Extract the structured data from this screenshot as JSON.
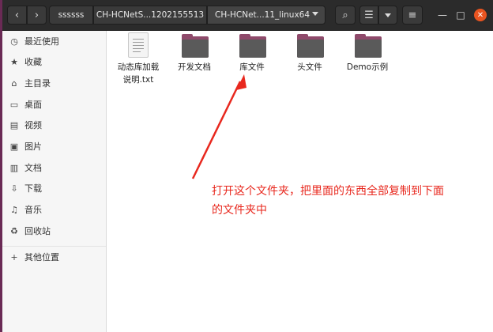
{
  "header": {
    "back_icon": "‹",
    "forward_icon": "›",
    "breadcrumbs": [
      "ssssss",
      "CH-HCNetS...1202155513",
      "CH-HCNet...11_linux64"
    ],
    "search_icon": "⌕",
    "view_icon": "☰",
    "menu_icon": "≡",
    "minimize_icon": "—",
    "maximize_icon": "□",
    "close_icon": "✕"
  },
  "sidebar": {
    "items": [
      {
        "icon": "◷",
        "label": "最近使用"
      },
      {
        "icon": "★",
        "label": "收藏"
      },
      {
        "icon": "⌂",
        "label": "主目录"
      },
      {
        "icon": "▭",
        "label": "桌面"
      },
      {
        "icon": "▤",
        "label": "视频"
      },
      {
        "icon": "▣",
        "label": "图片"
      },
      {
        "icon": "▥",
        "label": "文档"
      },
      {
        "icon": "⇩",
        "label": "下载"
      },
      {
        "icon": "♫",
        "label": "音乐"
      },
      {
        "icon": "♻",
        "label": "回收站"
      },
      {
        "icon": "+",
        "label": "其他位置"
      }
    ]
  },
  "files": [
    {
      "name_line1": "动态库加载",
      "name_line2": "说明.txt",
      "type": "text-file"
    },
    {
      "name_line1": "开发文档",
      "type": "folder"
    },
    {
      "name_line1": "库文件",
      "type": "folder"
    },
    {
      "name_line1": "头文件",
      "type": "folder"
    },
    {
      "name_line1": "Demo示例",
      "type": "folder"
    }
  ],
  "annotation": {
    "line1": "打开这个文件夹，把里面的东西全部复制到下面",
    "line2": "的文件夹中",
    "color": "#e8281e"
  }
}
